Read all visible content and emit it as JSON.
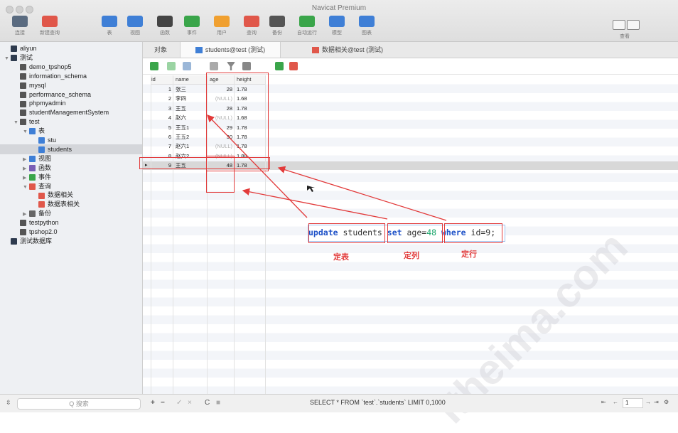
{
  "window": {
    "title": "Navicat Premium"
  },
  "toolbar": {
    "items": [
      {
        "label": "连接",
        "icon": "connection-icon",
        "color": "#5a6b80"
      },
      {
        "label": "新建查询",
        "icon": "new-query-icon",
        "color": "#e0574a"
      },
      {
        "label": "表",
        "icon": "table-icon",
        "color": "#3f7fd6"
      },
      {
        "label": "视图",
        "icon": "view-icon",
        "color": "#3f7fd6"
      },
      {
        "label": "函数",
        "icon": "function-icon",
        "color": "#444444"
      },
      {
        "label": "事件",
        "icon": "event-icon",
        "color": "#3aa54a"
      },
      {
        "label": "用户",
        "icon": "user-icon",
        "color": "#f0a030"
      },
      {
        "label": "查询",
        "icon": "query-icon",
        "color": "#e0574a"
      },
      {
        "label": "备份",
        "icon": "backup-icon",
        "color": "#555555"
      },
      {
        "label": "自动运行",
        "icon": "automation-icon",
        "color": "#3aa54a"
      },
      {
        "label": "模型",
        "icon": "model-icon",
        "color": "#3f7fd6"
      },
      {
        "label": "图表",
        "icon": "chart-icon",
        "color": "#3f7fd6"
      }
    ],
    "view_label": "查看"
  },
  "sidebar": {
    "items": [
      {
        "label": "aliyun",
        "level": 0,
        "icon": "server-icon",
        "tri": ""
      },
      {
        "label": "测试",
        "level": 0,
        "icon": "server-icon",
        "tri": "▼"
      },
      {
        "label": "demo_tpshop5",
        "level": 1,
        "icon": "database-icon",
        "tri": ""
      },
      {
        "label": "information_schema",
        "level": 1,
        "icon": "database-icon",
        "tri": ""
      },
      {
        "label": "mysql",
        "level": 1,
        "icon": "database-icon",
        "tri": ""
      },
      {
        "label": "performance_schema",
        "level": 1,
        "icon": "database-icon",
        "tri": ""
      },
      {
        "label": "phpmyadmin",
        "level": 1,
        "icon": "database-icon",
        "tri": ""
      },
      {
        "label": "studentManagementSystem",
        "level": 1,
        "icon": "database-icon",
        "tri": ""
      },
      {
        "label": "test",
        "level": 1,
        "icon": "database-icon",
        "tri": "▼"
      },
      {
        "label": "表",
        "level": 2,
        "icon": "table-icon",
        "tri": "▼"
      },
      {
        "label": "stu",
        "level": 3,
        "icon": "table-icon",
        "tri": ""
      },
      {
        "label": "students",
        "level": 3,
        "icon": "table-icon",
        "tri": "",
        "selected": true
      },
      {
        "label": "视图",
        "level": 2,
        "icon": "view-icon",
        "tri": "▶"
      },
      {
        "label": "函数",
        "level": 2,
        "icon": "function-icon",
        "tri": "▶"
      },
      {
        "label": "事件",
        "level": 2,
        "icon": "event-icon",
        "tri": "▶"
      },
      {
        "label": "查询",
        "level": 2,
        "icon": "query-icon",
        "tri": "▼"
      },
      {
        "label": "数据相关",
        "level": 3,
        "icon": "query-icon",
        "tri": ""
      },
      {
        "label": "数据表相关",
        "level": 3,
        "icon": "query-icon",
        "tri": ""
      },
      {
        "label": "备份",
        "level": 2,
        "icon": "backup-icon",
        "tri": "▶"
      },
      {
        "label": "testpython",
        "level": 1,
        "icon": "database-icon",
        "tri": ""
      },
      {
        "label": "tpshop2.0",
        "level": 1,
        "icon": "database-icon",
        "tri": ""
      },
      {
        "label": "测试数据库",
        "level": 0,
        "icon": "server-icon",
        "tri": ""
      }
    ],
    "search_placeholder": "Q 搜索"
  },
  "tabs": [
    {
      "label": "对象",
      "active": false
    },
    {
      "label": "students@test (测试)",
      "active": true
    },
    {
      "label": "数据相关@test (测试)",
      "active": false
    }
  ],
  "table": {
    "columns": [
      "id",
      "name",
      "age",
      "height"
    ],
    "rows": [
      [
        "1",
        "张三",
        "28",
        "1.78"
      ],
      [
        "2",
        "李四",
        "(NULL)",
        "1.68"
      ],
      [
        "3",
        "王五",
        "28",
        "1.78"
      ],
      [
        "4",
        "赵六",
        "(NULL)",
        "1.68"
      ],
      [
        "5",
        "王五1",
        "29",
        "1.78"
      ],
      [
        "6",
        "王五2",
        "30",
        "1.78"
      ],
      [
        "7",
        "赵六1",
        "(NULL)",
        "1.78"
      ],
      [
        "8",
        "赵六2",
        "(NULL)",
        "1.88"
      ],
      [
        "9",
        "王五",
        "48",
        "1.78"
      ]
    ],
    "selected_row_marker": "▸"
  },
  "annotation": {
    "sql": {
      "kw_update": "update",
      "table": " students ",
      "kw_set": "set",
      "assign": " age=",
      "value": "48",
      "kw_where": " where",
      "cond": " id=9;"
    },
    "labels": [
      "定表",
      "定列",
      "定行"
    ]
  },
  "bottombar": {
    "add": "+",
    "remove": "−",
    "apply": "✓",
    "discard": "×",
    "refresh": "C",
    "stop": "■",
    "status": "SELECT * FROM `test`.`students` LIMIT 0,1000",
    "page": "1"
  },
  "watermark": "itheima.com"
}
